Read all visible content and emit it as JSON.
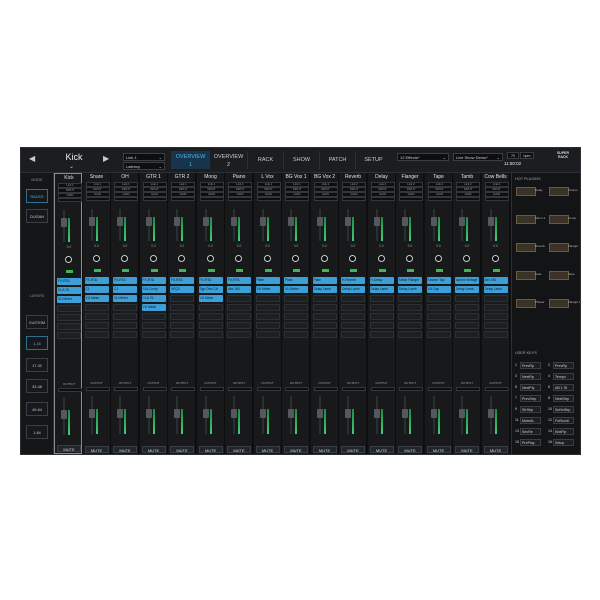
{
  "header": {
    "selected_channel": "Kick",
    "link_dropdown": "Link 1",
    "latency_dropdown": "Latency",
    "nav_tabs": [
      "OVERVIEW\n1",
      "OVERVIEW\n2",
      "RACK",
      "SHOW",
      "PATCH",
      "SETUP"
    ],
    "effects_dropdown": "12 Effects*",
    "show_dropdown": "Live Show Demo*",
    "tempo": "70",
    "tempo_unit": "bpm",
    "time": "11:50:02",
    "window_dropdown": "Window",
    "logo_line1": "SUPER",
    "logo_line2": "RACK"
  },
  "left_panel": {
    "mode_label": "MODE",
    "mode_buttons": [
      "RACKS",
      "DUGAN"
    ],
    "layers_label": "LAYERS",
    "layer_buttons": [
      "CUSTOM",
      "1-16",
      "17-32",
      "33-48",
      "49-64",
      "1-64"
    ],
    "active_layer": "1-16"
  },
  "channels": [
    {
      "name": "Kick",
      "link": "Link 1",
      "plugins": [
        "FX-RTA",
        "CLA 76",
        "VU Meter"
      ]
    },
    {
      "name": "Snare",
      "link": "Link 1",
      "plugins": [
        "FX-RTA",
        "C1",
        "VU Meter"
      ]
    },
    {
      "name": "OH",
      "link": "Link 1",
      "plugins": [
        "FX-RTA",
        "C1",
        "VU Meter"
      ]
    },
    {
      "name": "GTR 1",
      "link": "Link 1",
      "plugins": [
        "FX-RTA",
        "SSLComp",
        "CLA 76",
        "VU Meter"
      ]
    },
    {
      "name": "GTR 2",
      "link": "Link 1",
      "plugins": [
        "FX-RTA",
        "VEQ3"
      ]
    },
    {
      "name": "Moog",
      "link": "Link 1",
      "plugins": [
        "FX-RTA",
        "Syp One CA",
        "VU Meter"
      ]
    },
    {
      "name": "Piano",
      "link": "Link 1",
      "plugins": [
        "FX-RTA",
        "dbx 160"
      ]
    },
    {
      "name": "L Vox",
      "link": "Link 1",
      "plugins": [
        "Plate",
        "VU Meter"
      ]
    },
    {
      "name": "BG Vox 1",
      "link": "Link 1",
      "plugins": [
        "Plate",
        "VU Meter"
      ]
    },
    {
      "name": "BG Vox 2",
      "link": "Link 2",
      "plugins": [
        "Plate",
        "Delay Lamb"
      ]
    },
    {
      "name": "Reverb",
      "link": "Link 2",
      "plugins": [
        "H-Reverb",
        "Delay Lamb"
      ]
    },
    {
      "name": "Delay",
      "link": "Link 2",
      "plugins": [
        "H-Delay",
        "Delay Lamb"
      ]
    },
    {
      "name": "Flanger",
      "link": "Link 2",
      "plugins": [
        "Metal Flanger",
        "Delay Lamb"
      ]
    },
    {
      "name": "Tape",
      "link": "Link 2",
      "plugins": [
        "Kramer Tap",
        "VU Cap"
      ]
    },
    {
      "name": "Tamb",
      "link": "Link 2",
      "plugins": [
        "Aphex Vintage",
        "Delay Lamb"
      ]
    },
    {
      "name": "Cow Bells",
      "link": "Link 2",
      "plugins": [
        "dbx 160",
        "Delay Lamb"
      ]
    }
  ],
  "strip_labels": {
    "input": "INPUT",
    "gain": "GAIN",
    "output": "OUTPUT",
    "gain_value": "0.0",
    "mute": "MUTE"
  },
  "right_panel": {
    "hot_plugins_label": "HOT PLUGINS",
    "hot_plugins": [
      "Delay",
      "Chorus",
      "Mono 3",
      "Comp",
      "Reverb",
      "Flanger",
      "Gate",
      "Tape",
      "Phaser",
      "Flanger Dist"
    ],
    "user_keys_label": "USER KEYS",
    "user_keys": [
      {
        "num": "1",
        "label": "PrevRp"
      },
      {
        "num": "2",
        "label": "PrevRp"
      },
      {
        "num": "3",
        "label": "NextRp"
      },
      {
        "num": "4",
        "label": "Tempo"
      },
      {
        "num": "5",
        "label": "NextPly"
      },
      {
        "num": "6",
        "label": "AB 1 St"
      },
      {
        "num": "7",
        "label": "PrevStrp"
      },
      {
        "num": "8",
        "label": "NextStrp"
      },
      {
        "num": "9",
        "label": "StrStrp"
      },
      {
        "num": "10",
        "label": "SnNxStrp"
      },
      {
        "num": "11",
        "label": "MuteAL"
      },
      {
        "num": "12",
        "label": "FstScroll"
      },
      {
        "num": "13",
        "label": "SecRe"
      },
      {
        "num": "14",
        "label": "KbdFlp"
      },
      {
        "num": "15",
        "label": "PrePlay"
      },
      {
        "num": "16",
        "label": "Setup"
      }
    ]
  },
  "colors": {
    "accent": "#3d9fd8",
    "meter_green": "#3fd06e",
    "background": "#0f1012"
  }
}
